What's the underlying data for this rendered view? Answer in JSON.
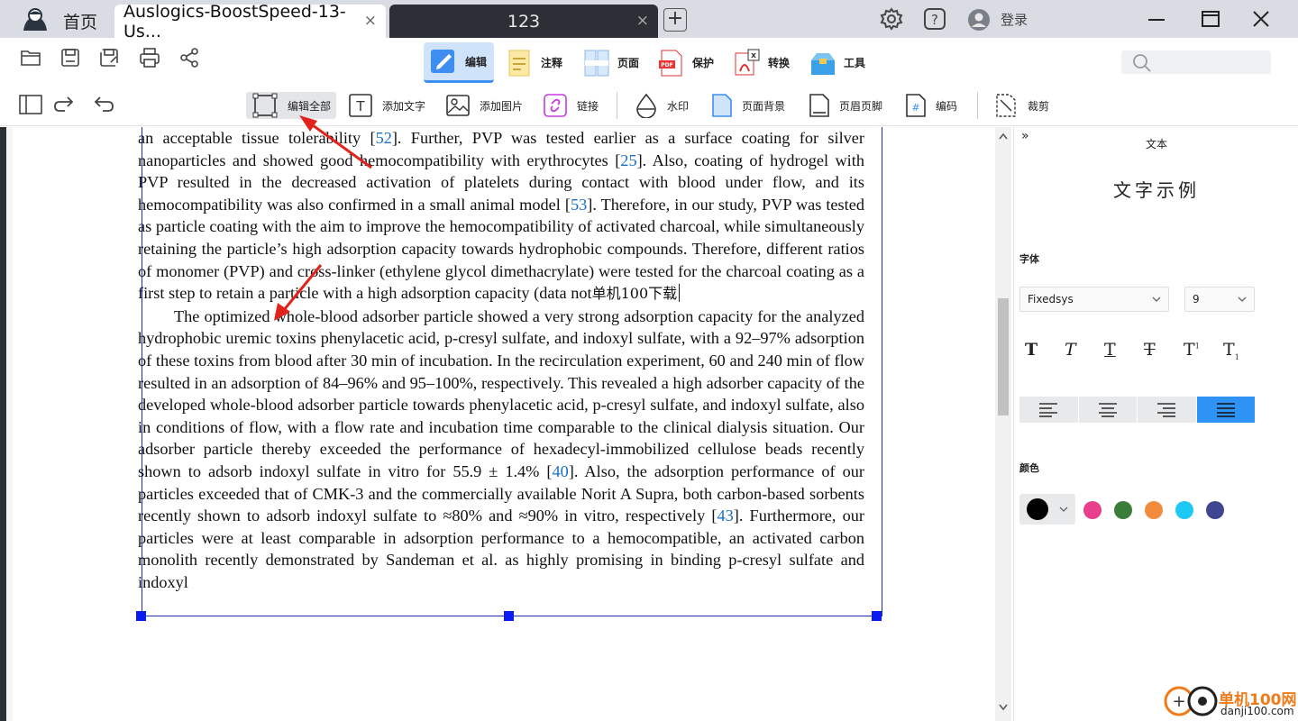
{
  "titlebar": {
    "home_label": "首页",
    "tabs": [
      {
        "label": "Auslogics-BoostSpeed-13-Us...",
        "active": true
      },
      {
        "label": "123",
        "active": false
      }
    ],
    "add_tab_symbol": "+",
    "close_symbol": "×",
    "login_label": "登录",
    "icons": [
      "settings-icon",
      "help-icon",
      "user-icon",
      "minimize-icon",
      "maximize-icon",
      "close-icon"
    ]
  },
  "main_tabs": [
    {
      "label": "编辑",
      "icon": "edit-icon",
      "active": true
    },
    {
      "label": "注释",
      "icon": "annotate-icon"
    },
    {
      "label": "页面",
      "icon": "page-icon"
    },
    {
      "label": "保护",
      "icon": "protect-icon"
    },
    {
      "label": "转换",
      "icon": "convert-icon"
    },
    {
      "label": "工具",
      "icon": "tools-icon"
    }
  ],
  "file_tools": [
    "open-icon",
    "save-icon",
    "save-as-icon",
    "print-icon",
    "share-icon"
  ],
  "edit_tools": [
    {
      "label": "编辑全部",
      "icon": "edit-all-icon",
      "active": true
    },
    {
      "label": "添加文字",
      "icon": "add-text-icon"
    },
    {
      "label": "添加图片",
      "icon": "add-image-icon"
    },
    {
      "label": "链接",
      "icon": "link-icon"
    },
    {
      "label": "水印",
      "icon": "watermark-icon"
    },
    {
      "label": "页面背景",
      "icon": "page-background-icon"
    },
    {
      "label": "页眉页脚",
      "icon": "header-footer-icon"
    },
    {
      "label": "编码",
      "icon": "bates-number-icon"
    },
    {
      "label": "裁剪",
      "icon": "crop-icon"
    }
  ],
  "document": {
    "p1_a": "an acceptable tissue tolerability [",
    "p1_ref1": "52",
    "p1_b": "]. Further, PVP was tested earlier as a surface coating for silver nanoparticles and showed good hemocompatibility with erythrocytes [",
    "p1_ref2": "25",
    "p1_c": "]. Also, coating of hydrogel with PVP resulted in the decreased activation of platelets during contact with blood under flow, and its hemocompatibility was also confirmed in a small animal model [",
    "p1_ref3": "53",
    "p1_d": "]. Therefore, in our study, PVP was tested as particle coating with the aim to improve the hemocompatibility of activated charcoal, while simultaneously retaining the particle’s high adsorption capacity towards hydrophobic compounds. Therefore, different ratios of monomer (PVP) and cross-linker (ethylene glycol dimethacrylate) were tested for the charcoal coating as a first step to retain a particle with a high adsorption capacity (data not",
    "p1_inserted": "单机100下载",
    "p2_a": "The optimized whole-blood adsorber particle showed a very strong adsorption capacity for the analyzed hydrophobic uremic toxins phenylacetic acid, p-cresyl sulfate, and indoxyl sulfate, with a 92–97% adsorption of these toxins from blood after 30 min of incubation.  In the recirculation experiment, 60 and 240 min of flow resulted in an adsorption of 84–96% and 95–100%, respectively. This revealed a high adsorber capacity of the developed whole-blood adsorber particle towards phenylacetic acid, p-cresyl sulfate, and indoxyl sulfate, also in conditions of flow, with a flow rate and incubation time comparable to the clinical dialysis situation. Our adsorber particle thereby exceeded the performance of hexadecyl-immobilized cellulose beads recently shown to adsorb indoxyl sulfate in vitro for 55.9 ± 1.4% [",
    "p2_ref1": "40",
    "p2_b": "].  Also, the adsorption performance of our particles exceeded that of CMK-3 and the commercially available Norit A Supra, both carbon-based sorbents recently shown to adsorb indoxyl sulfate to ≈80% and ≈90% in vitro, respectively [",
    "p2_ref2": "43",
    "p2_c": "]. Furthermore, our particles were at least comparable in adsorption performance to a hemocompatible, an activated carbon monolith recently demonstrated by Sandeman et al.  as highly promising in binding p-cresyl sulfate and indoxyl"
  },
  "panel": {
    "collapse_symbol": "»",
    "title": "文本",
    "sample_text": "文字示例",
    "font_label": "字体",
    "font_value": "Fixedsys",
    "size_value": "9",
    "style_buttons": [
      "T",
      "T",
      "T",
      "T",
      "T",
      "T"
    ],
    "color_label": "颜色",
    "colors": {
      "current": "#000000",
      "swatches": [
        "#e83e8c",
        "#3a7d3a",
        "#f28c3c",
        "#1ec8f5",
        "#3f4590"
      ]
    },
    "accent": "#2f93f5"
  },
  "watermark": {
    "title": "单机100网",
    "url": "danji100.com"
  }
}
